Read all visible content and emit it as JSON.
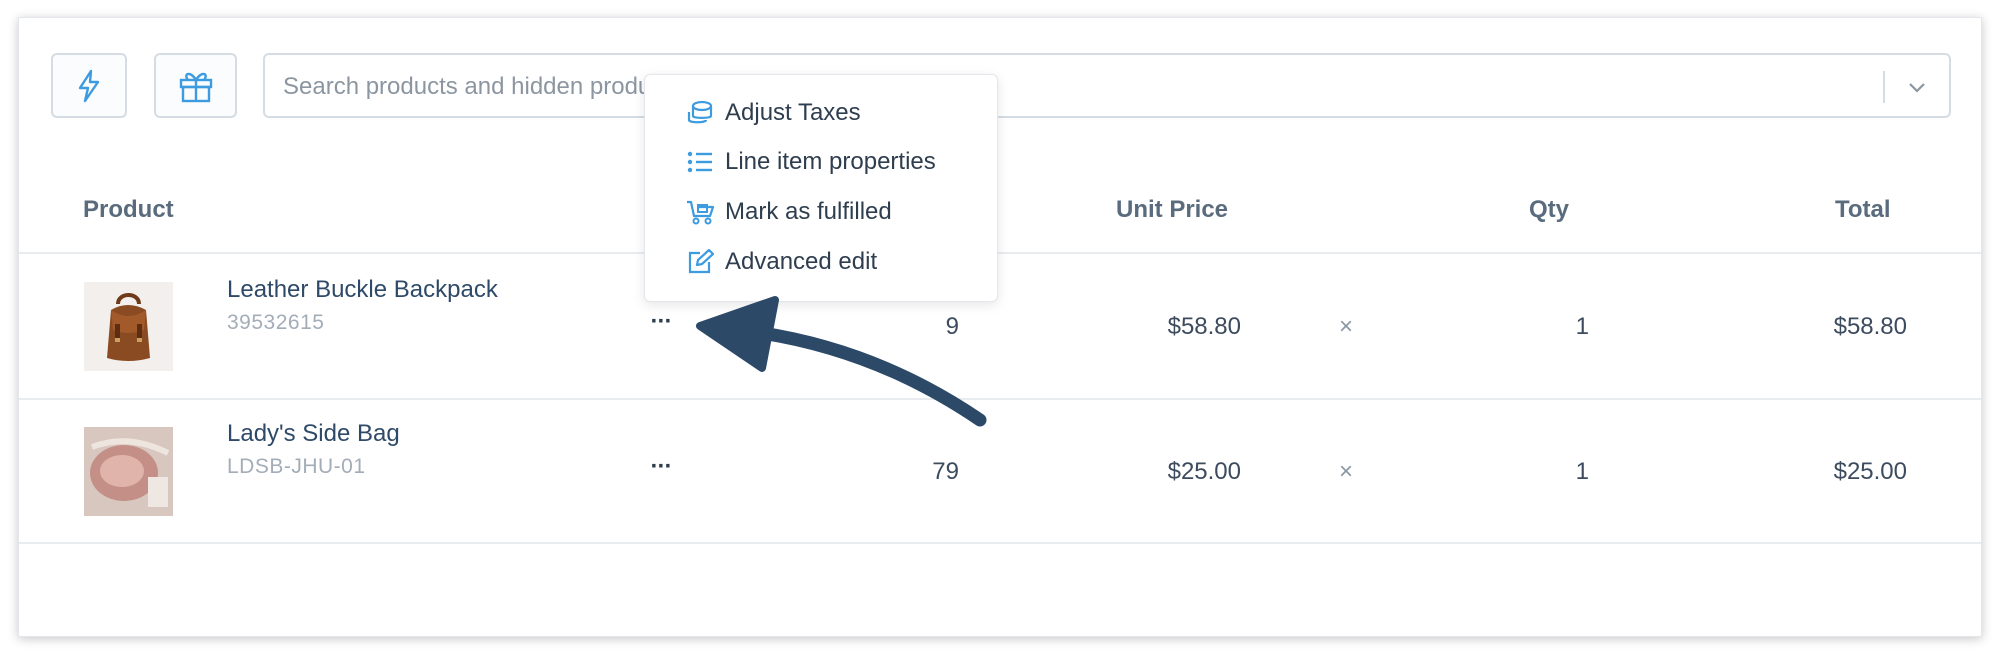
{
  "toolbar": {
    "quick_icon": "lightning-icon",
    "gift_icon": "gift-icon",
    "search_placeholder": "Search products and hidden products by name, SKU or barcode..."
  },
  "table": {
    "headers": {
      "product": "Product",
      "unit_price": "Unit Price",
      "qty": "Qty",
      "total": "Total"
    },
    "rows": [
      {
        "name": "Leather Buckle Backpack",
        "sku": "39532615",
        "more": "···",
        "stock": "9",
        "unit_price": "$58.80",
        "times": "×",
        "qty": "1",
        "total": "$58.80"
      },
      {
        "name": "Lady's Side Bag",
        "sku": "LDSB-JHU-01",
        "more": "···",
        "stock": "79",
        "unit_price": "$25.00",
        "times": "×",
        "qty": "1",
        "total": "$25.00"
      }
    ]
  },
  "context_menu": {
    "items": [
      {
        "label": "Adjust Taxes",
        "icon": "coins-icon"
      },
      {
        "label": "Line item properties",
        "icon": "list-icon"
      },
      {
        "label": "Mark as fulfilled",
        "icon": "truck-icon"
      },
      {
        "label": "Advanced edit",
        "icon": "edit-icon"
      }
    ]
  },
  "colors": {
    "accent": "#3d9be0",
    "arrow": "#2c4a68",
    "text": "#3c4b5e"
  }
}
